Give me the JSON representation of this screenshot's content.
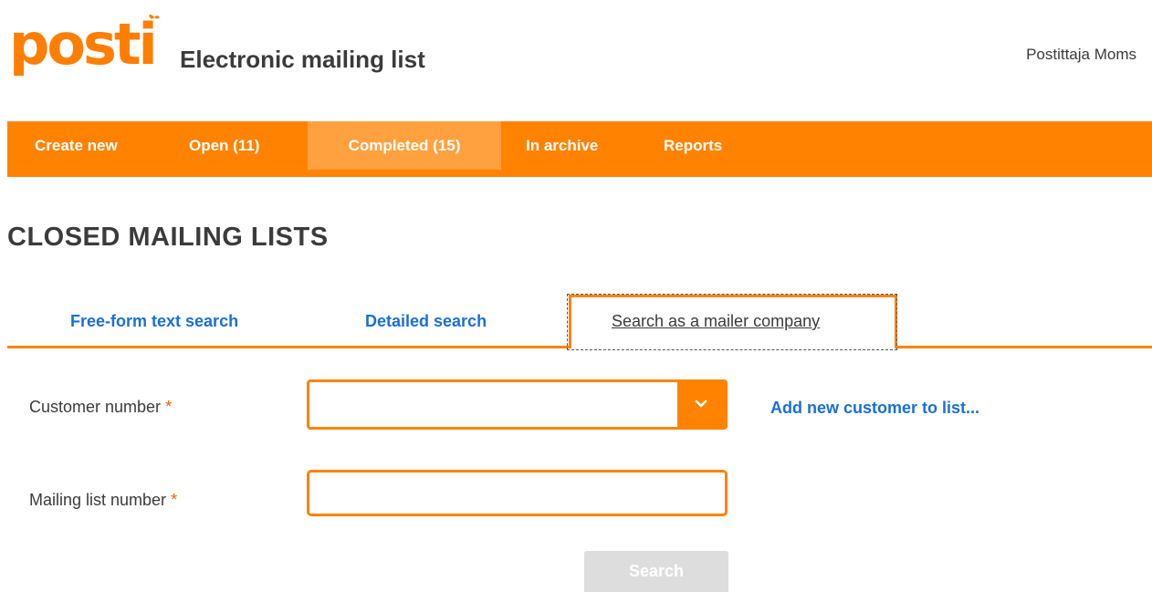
{
  "header": {
    "logo_text": "posti",
    "app_title": "Electronic mailing list",
    "user_name": "Postittaja Moms"
  },
  "nav": {
    "items": [
      {
        "label": "Create new"
      },
      {
        "label": "Open (11)"
      },
      {
        "label": "Completed (15)",
        "active": true
      },
      {
        "label": "In archive"
      },
      {
        "label": "Reports"
      }
    ]
  },
  "page": {
    "title": "CLOSED MAILING LISTS"
  },
  "tabs": [
    {
      "label": "Free-form text search"
    },
    {
      "label": "Detailed search"
    },
    {
      "label": "Search as a mailer company",
      "active": true
    }
  ],
  "form": {
    "customer_number_label": "Customer number",
    "customer_number_value": "",
    "add_customer_link": "Add new customer to list...",
    "mailing_list_label": "Mailing list number",
    "mailing_list_value": "",
    "required_marker": "*",
    "search_button": "Search"
  },
  "colors": {
    "brand_orange": "#ff8300",
    "nav_active": "#ffa13f",
    "link_blue": "#1a6fd6",
    "disabled_button": "#dddddd"
  }
}
